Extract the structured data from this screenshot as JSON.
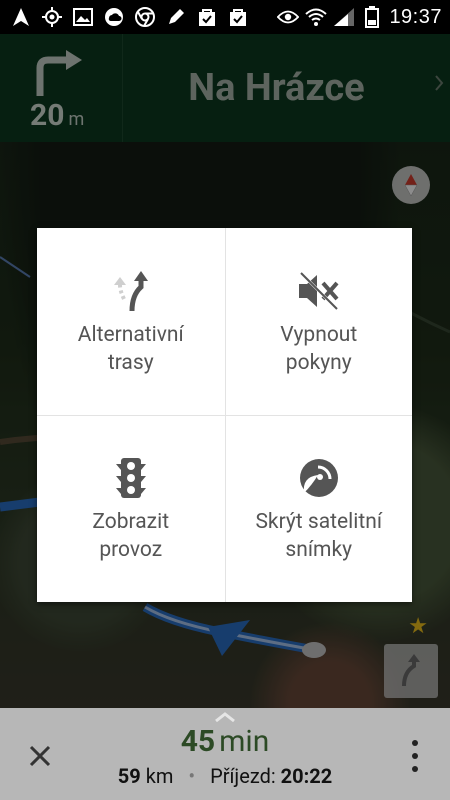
{
  "statusbar": {
    "time": "19:37",
    "left_icons": [
      "navigation-icon",
      "gps-icon",
      "image-icon",
      "cloud-icon",
      "chrome-icon",
      "pen-icon",
      "bag-check-icon",
      "bag-check-icon"
    ],
    "right_icons": [
      "eye-icon",
      "wifi-icon",
      "signal-icon",
      "battery-icon"
    ]
  },
  "nav": {
    "distance_value": "20",
    "distance_unit": "m",
    "street": "Na Hrázce",
    "maneuver": "turn-right"
  },
  "map": {
    "compass_icon": "compass-icon",
    "reroute_icon": "alternate-route-icon"
  },
  "dialog": {
    "items": [
      {
        "label": "Alternativní\ntrasy",
        "icon": "alternate-routes-icon"
      },
      {
        "label": "Vypnout\npokyny",
        "icon": "mute-icon"
      },
      {
        "label": "Zobrazit\nprovoz",
        "icon": "traffic-icon"
      },
      {
        "label": "Skrýt satelitní\nsnímky",
        "icon": "satellite-icon"
      }
    ]
  },
  "bottom": {
    "eta_value": "45",
    "eta_unit": "min",
    "distance_value": "59",
    "distance_unit": "km",
    "arrival_label": "Příjezd:",
    "arrival_time": "20:22",
    "accent_color": "#2c4a25"
  }
}
